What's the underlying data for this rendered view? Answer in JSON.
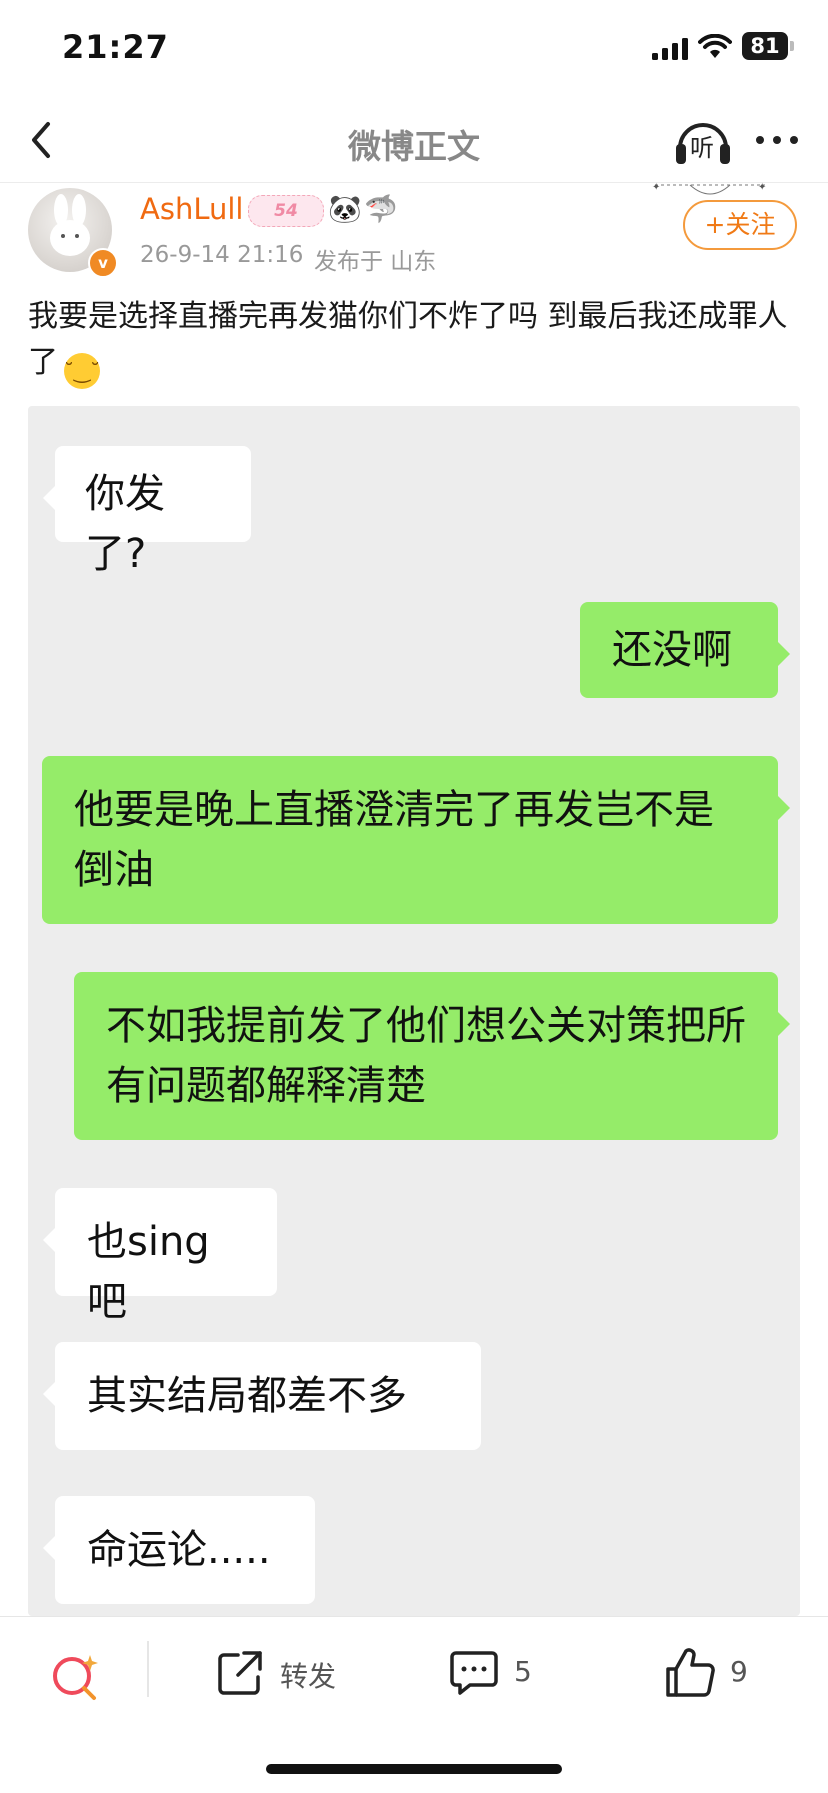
{
  "status_bar": {
    "time": "21:27",
    "battery": "81"
  },
  "nav": {
    "title": "微博正文",
    "listen_label": "听"
  },
  "author": {
    "name": "AshLull",
    "level_badge": "54",
    "verified_mark": "v",
    "post_time": "26-9-14 21:16",
    "location": "发布于 山东",
    "follow_label": "+关注"
  },
  "post": {
    "text": "我要是选择直播完再发猫你们不炸了吗 到最后我还成罪人了"
  },
  "chat": {
    "messages": [
      {
        "side": "left",
        "text": "你发了?"
      },
      {
        "side": "right",
        "text": "还没啊"
      },
      {
        "side": "right",
        "text": "他要是晚上直播澄清完了再发岂不是倒油"
      },
      {
        "side": "right",
        "text": "不如我提前发了他们想公关对策把所有问题都解释清楚"
      },
      {
        "side": "left",
        "text": "也sing吧"
      },
      {
        "side": "left",
        "text": "其实结局都差不多"
      },
      {
        "side": "left",
        "text": "命运论....."
      }
    ]
  },
  "actions": {
    "repost_label": "转发",
    "comment_count": "5",
    "like_count": "9"
  },
  "colors": {
    "accent": "#f07a16",
    "bubble_green": "#95ec69",
    "chat_bg": "#ededed"
  },
  "icons": [
    "back-icon",
    "listen-icon",
    "more-icon",
    "search-icon",
    "repost-icon",
    "comment-icon",
    "like-icon"
  ]
}
